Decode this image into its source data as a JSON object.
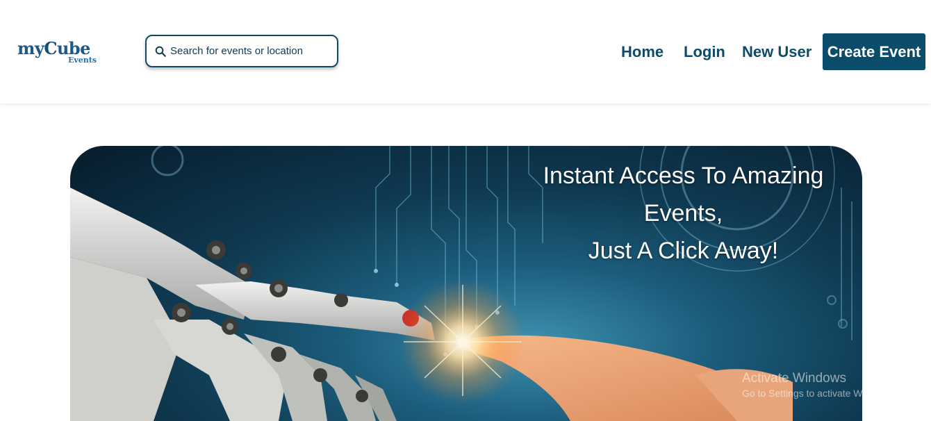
{
  "header": {
    "logo": {
      "main_prefix": "my",
      "main_c": "C",
      "main_suffix": "ube",
      "sub": "Events"
    },
    "search": {
      "placeholder": "Search for events or location",
      "value": ""
    },
    "nav": {
      "home": "Home",
      "login": "Login",
      "new_user": "New User",
      "create_event": "Create Event"
    }
  },
  "hero": {
    "headline_line1": "Instant Access To Amazing",
    "headline_line2": "Events,",
    "headline_line3": "Just A Click Away!"
  },
  "watermark": {
    "title": "Activate Windows",
    "subtitle": "Go to Settings to activate Windows."
  },
  "colors": {
    "brand": "#0b4c6b",
    "logo": "#1c5a87"
  },
  "icons": [
    "search-icon"
  ]
}
